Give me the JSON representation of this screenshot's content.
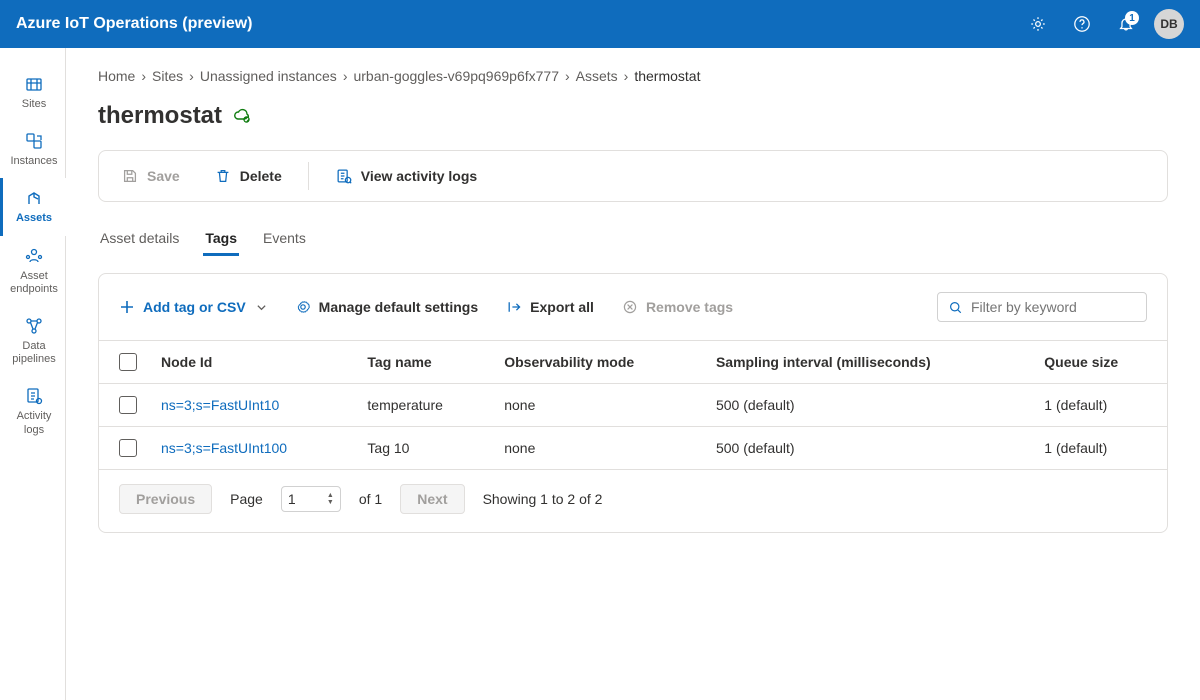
{
  "app": {
    "title": "Azure IoT Operations (preview)"
  },
  "topbar": {
    "notif_count": "1",
    "avatar_initials": "DB"
  },
  "nav": {
    "items": [
      {
        "label": "Sites"
      },
      {
        "label": "Instances"
      },
      {
        "label": "Assets"
      },
      {
        "label": "Asset endpoints"
      },
      {
        "label": "Data pipelines"
      },
      {
        "label": "Activity logs"
      }
    ],
    "active_index": 2
  },
  "breadcrumb": [
    "Home",
    "Sites",
    "Unassigned instances",
    "urban-goggles-v69pq969p6fx777",
    "Assets",
    "thermostat"
  ],
  "page": {
    "title": "thermostat"
  },
  "toolbar": {
    "save_label": "Save",
    "delete_label": "Delete",
    "activity_label": "View activity logs"
  },
  "tabs": [
    {
      "label": "Asset details"
    },
    {
      "label": "Tags"
    },
    {
      "label": "Events"
    }
  ],
  "tabs_active_index": 1,
  "panel_actions": {
    "add_label": "Add tag or CSV",
    "manage_label": "Manage default settings",
    "export_label": "Export all",
    "remove_label": "Remove tags"
  },
  "filter": {
    "placeholder": "Filter by keyword"
  },
  "table": {
    "columns": [
      "Node Id",
      "Tag name",
      "Observability mode",
      "Sampling interval (milliseconds)",
      "Queue size"
    ],
    "rows": [
      {
        "node_id": "ns=3;s=FastUInt10",
        "tag": "temperature",
        "obs": "none",
        "sampling": "500 (default)",
        "queue": "1 (default)"
      },
      {
        "node_id": "ns=3;s=FastUInt100",
        "tag": "Tag 10",
        "obs": "none",
        "sampling": "500 (default)",
        "queue": "1 (default)"
      }
    ]
  },
  "pager": {
    "prev": "Previous",
    "next": "Next",
    "page_label": "Page",
    "page_value": "1",
    "of_label": "of 1",
    "showing": "Showing 1 to 2 of 2"
  }
}
